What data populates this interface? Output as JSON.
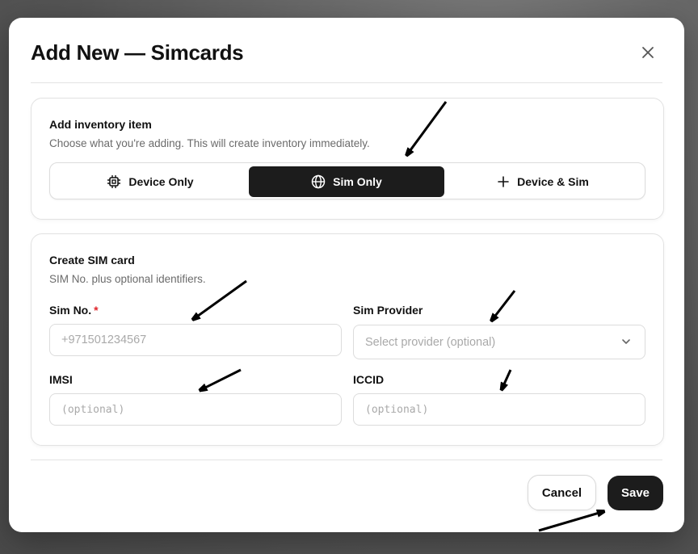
{
  "modal": {
    "title": "Add New — Simcards",
    "close_icon": "close-icon"
  },
  "inventory_card": {
    "title": "Add inventory item",
    "subtitle": "Choose what you're adding. This will create inventory immediately.",
    "options": [
      {
        "label": "Device Only",
        "icon": "chip-icon",
        "selected": false
      },
      {
        "label": "Sim Only",
        "icon": "globe-icon",
        "selected": true
      },
      {
        "label": "Device & Sim",
        "icon": "plus-icon",
        "selected": false
      }
    ]
  },
  "sim_card": {
    "title": "Create SIM card",
    "subtitle": "SIM No. plus optional identifiers.",
    "fields": {
      "sim_no": {
        "label": "Sim No.",
        "required_mark": "*",
        "placeholder": "+971501234567"
      },
      "sim_provider": {
        "label": "Sim Provider",
        "placeholder": "Select provider (optional)",
        "icon": "chevron-down-icon"
      },
      "imsi": {
        "label": "IMSI",
        "placeholder": "(optional)"
      },
      "iccid": {
        "label": "ICCID",
        "placeholder": "(optional)"
      }
    }
  },
  "footer": {
    "cancel_label": "Cancel",
    "save_label": "Save"
  },
  "colors": {
    "primary_dark": "#1c1c1c",
    "required": "#e0242a",
    "muted_text": "#6b6b6b",
    "border": "#dcdcdc"
  }
}
